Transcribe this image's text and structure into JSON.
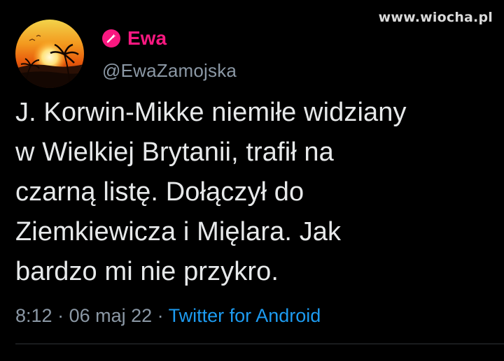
{
  "watermark": "www.wiocha.pl",
  "author": {
    "name": "Ewa",
    "handle": "@EwaZamojska",
    "name_icon": "pink-circle-wand-icon",
    "name_color": "#f91880",
    "avatar": "sunset-palm-avatar"
  },
  "tweet": {
    "lines": [
      "J. Korwin-Mikke niemiłe widziany",
      "w Wielkiej Brytanii, trafił na",
      "czarną listę. Dołączył do",
      "Ziemkiewicza i Mięlara. Jak",
      "bardzo mi nie przykro."
    ]
  },
  "meta": {
    "time": "8:12",
    "separator": " · ",
    "date": "06 maj 22",
    "source": "Twitter for Android",
    "source_color": "#1d9bf0"
  },
  "colors": {
    "background": "#000000",
    "text": "#e7e9ea",
    "secondary": "#8b98a5"
  }
}
